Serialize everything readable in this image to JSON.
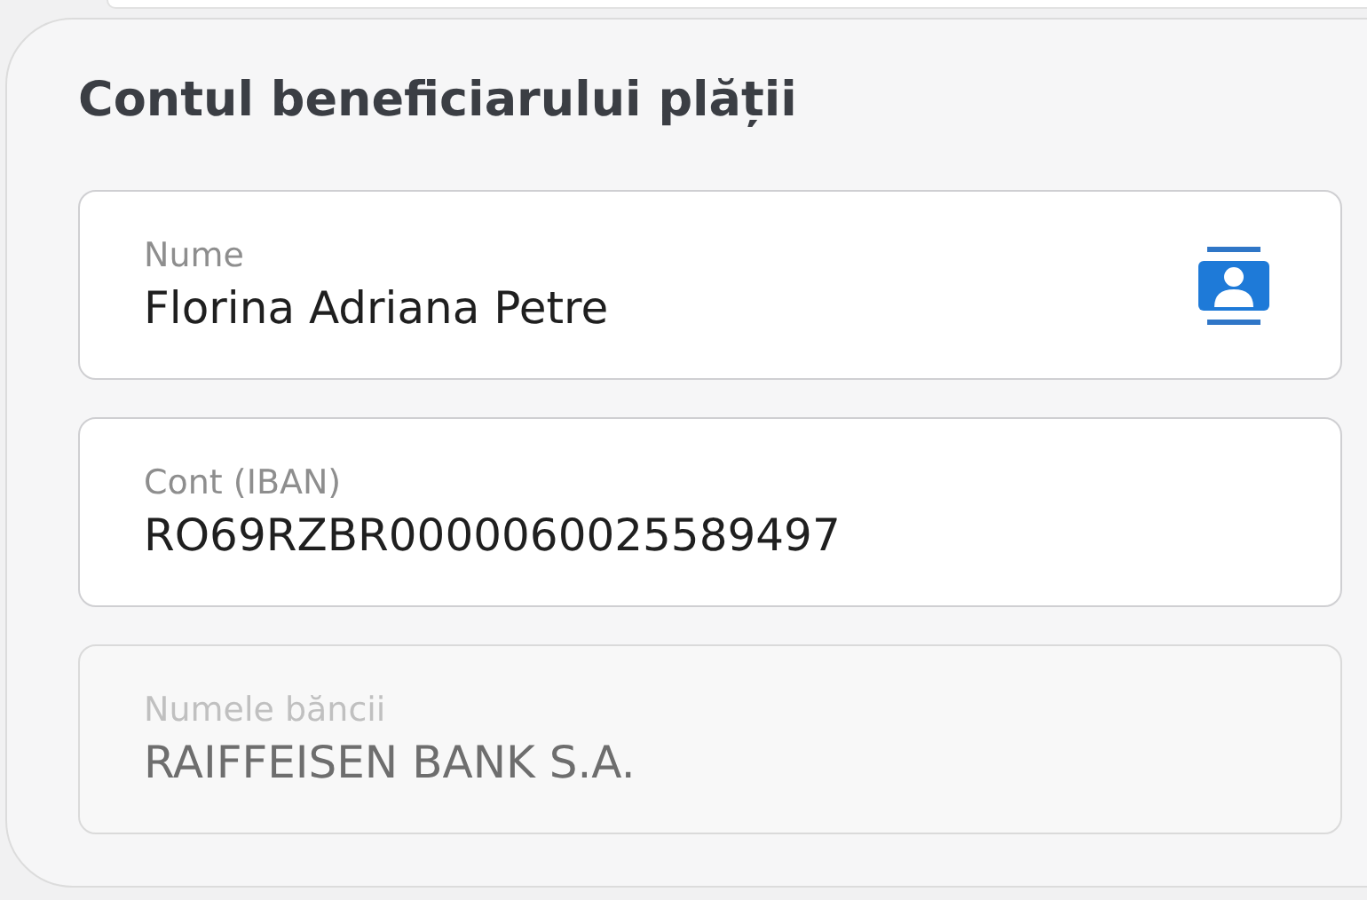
{
  "section": {
    "title": "Contul beneficiarului plății",
    "fields": [
      {
        "kind": "contact",
        "label": "Nume",
        "value": "Florina Adriana Petre",
        "disabled": false
      },
      {
        "kind": "text",
        "label": "Cont (IBAN)",
        "value": "RO69RZBR0000060025589497",
        "disabled": false
      },
      {
        "kind": "text",
        "label": "Numele băncii",
        "value": "RAIFFEISEN BANK S.A.",
        "disabled": true
      }
    ]
  }
}
